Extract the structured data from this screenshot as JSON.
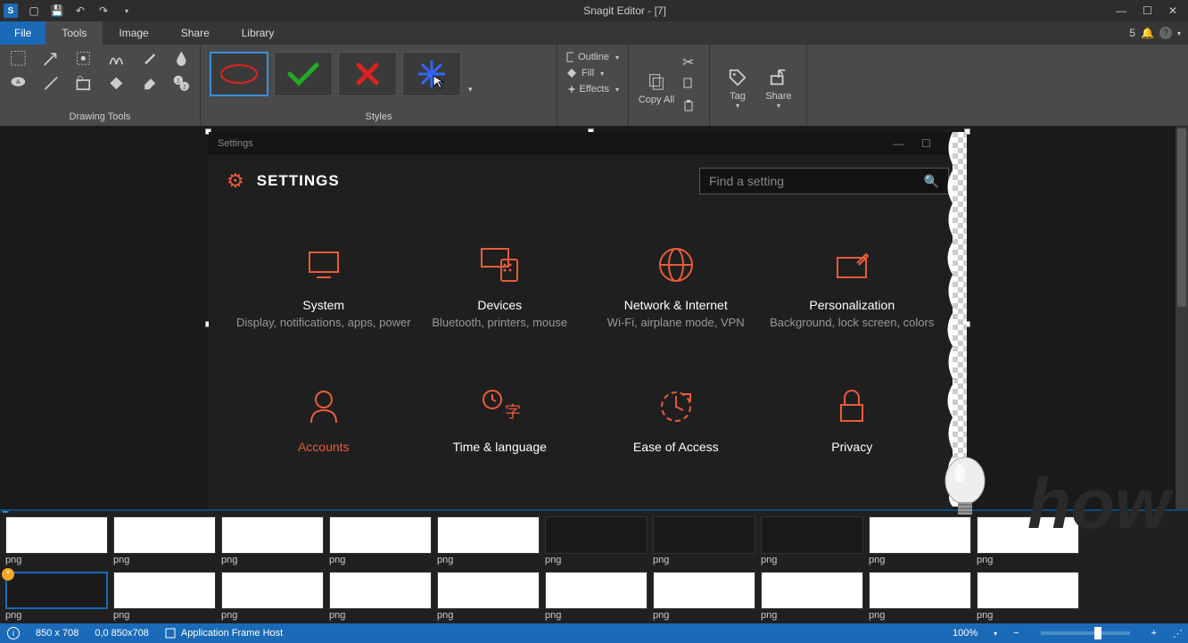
{
  "title": "Snagit Editor - [7]",
  "menus": {
    "file": "File",
    "tools": "Tools",
    "image": "Image",
    "share": "Share",
    "library": "Library"
  },
  "notif_count": "5",
  "ribbon": {
    "drawing_label": "Drawing Tools",
    "styles_label": "Styles",
    "outline": "Outline",
    "fill": "Fill",
    "effects": "Effects",
    "copy_all": "Copy All",
    "tag": "Tag",
    "share": "Share"
  },
  "canvas": {
    "inner_title": "Settings",
    "settings_heading": "SETTINGS",
    "search_placeholder": "Find a setting",
    "tiles": [
      {
        "title": "System",
        "desc": "Display, notifications, apps, power"
      },
      {
        "title": "Devices",
        "desc": "Bluetooth, printers, mouse"
      },
      {
        "title": "Network & Internet",
        "desc": "Wi-Fi, airplane mode, VPN"
      },
      {
        "title": "Personalization",
        "desc": "Background, lock screen, colors"
      },
      {
        "title": "Accounts",
        "desc": ""
      },
      {
        "title": "Time & language",
        "desc": ""
      },
      {
        "title": "Ease of Access",
        "desc": ""
      },
      {
        "title": "Privacy",
        "desc": ""
      }
    ]
  },
  "thumb_label": "png",
  "status": {
    "dims": "850 x 708",
    "coords": "0,0  850x708",
    "proc": "Application Frame Host",
    "zoom": "100%"
  }
}
